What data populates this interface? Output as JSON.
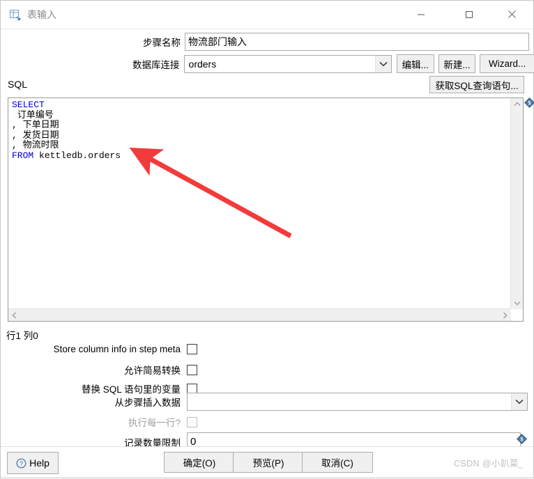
{
  "window": {
    "title": "表输入",
    "icon": "table-input-icon",
    "controls": {
      "minimize": "minimize-icon",
      "maximize": "maximize-icon",
      "close": "close-icon"
    }
  },
  "form": {
    "step_name_label": "步骤名称",
    "step_name_value": "物流部门输入",
    "connection_label": "数据库连接",
    "connection_value": "orders",
    "edit_button": "编辑...",
    "new_button": "新建...",
    "wizard_button": "Wizard...",
    "get_sql_button": "获取SQL查询语句..."
  },
  "sql": {
    "section_label": "SQL",
    "keyword_select": "SELECT",
    "keyword_from": "FROM",
    "line_1": " 订单编号",
    "line_2": ", 下单日期",
    "line_3": ", 发货日期",
    "line_4": ", 物流时限",
    "from_table": " kettledb.orders",
    "status": "行1 列0",
    "variable_badge": "dollar-diamond-icon"
  },
  "options": {
    "store_column_info_label": "Store column info in step meta",
    "store_column_info_checked": false,
    "lazy_conversion_label": "允许简易转换",
    "lazy_conversion_checked": false,
    "replace_variables_label": "替换 SQL 语句里的变量",
    "replace_variables_checked": false,
    "insert_data_from_step_label": "从步骤插入数据",
    "insert_data_from_step_value": "",
    "execute_each_row_label": "执行每一行?",
    "execute_each_row_checked": false,
    "execute_each_row_disabled": true,
    "limit_size_label": "记录数量限制",
    "limit_size_value": "0"
  },
  "buttons": {
    "help": "Help",
    "ok": "确定(O)",
    "preview": "预览(P)",
    "cancel": "取消(C)"
  },
  "watermark": "CSDN @小趴菜_",
  "colors": {
    "keyword": "#0000d0",
    "annotation_arrow": "#f23b3b",
    "title_text": "#8a8a8a",
    "watermark": "#bfbfbf"
  }
}
